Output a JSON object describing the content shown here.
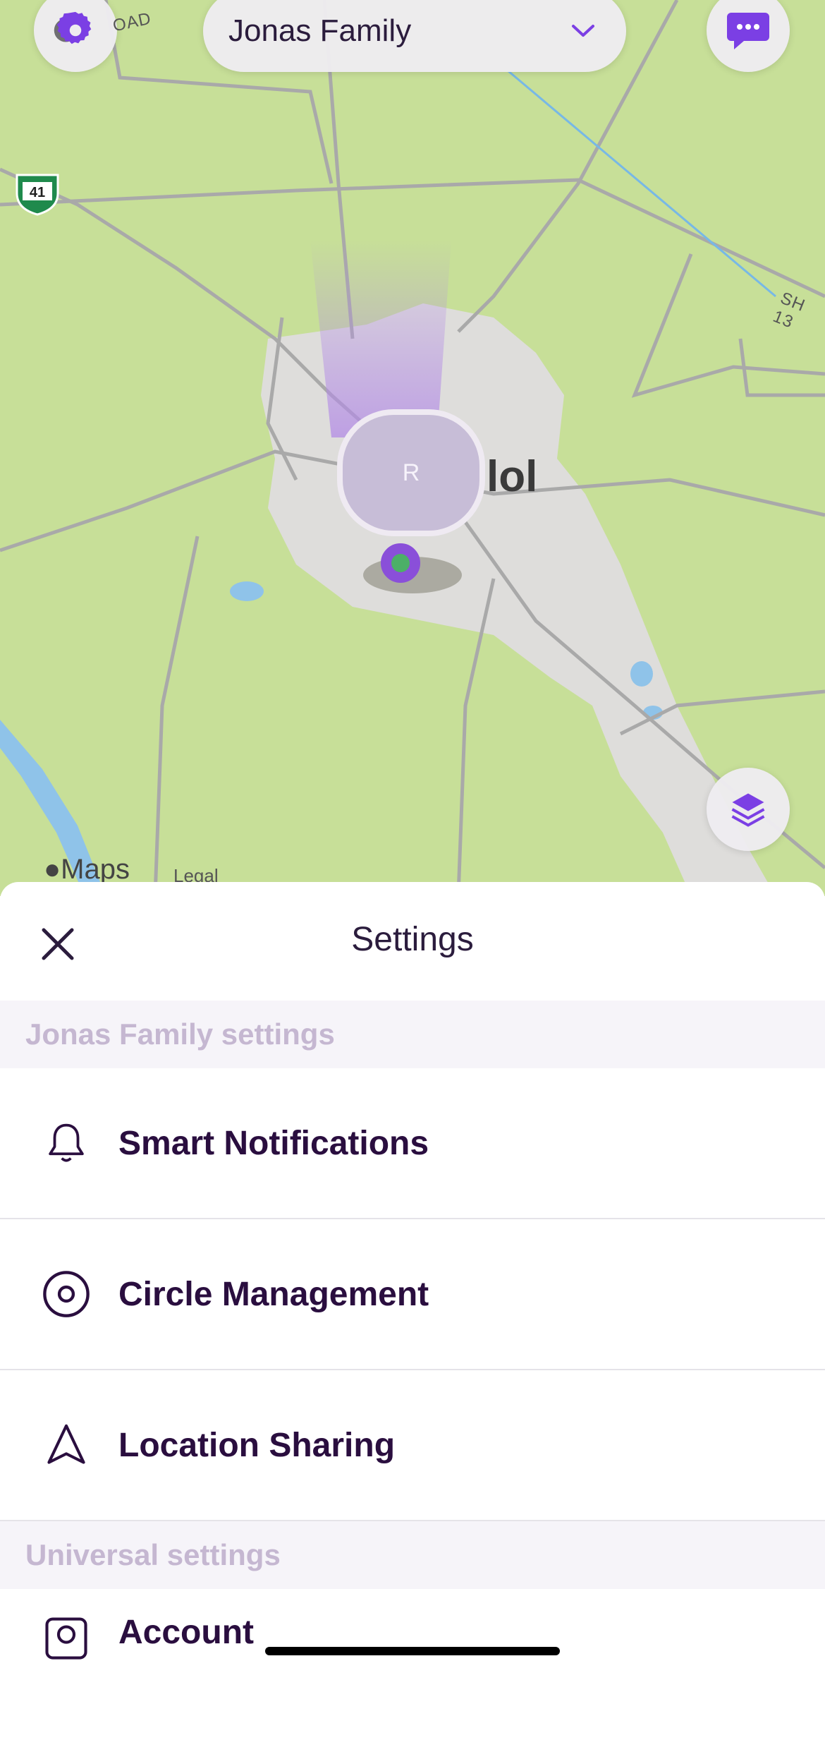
{
  "header": {
    "circle_name": "Jonas Family",
    "colors": {
      "accent": "#7b3fe4",
      "button_bg": "#eeecf0"
    }
  },
  "map": {
    "road_labels": {
      "highway_shield": "41",
      "road_top": "OAD",
      "road_right": "SH 13"
    },
    "city_label": "lol",
    "avatar_initial": "R",
    "attribution": "Maps",
    "legal": "Legal"
  },
  "settings_sheet": {
    "title": "Settings",
    "sections": [
      {
        "header": "Jonas Family settings",
        "items": [
          {
            "label": "Smart Notifications",
            "icon": "bell-icon"
          },
          {
            "label": "Circle Management",
            "icon": "circle-target-icon"
          },
          {
            "label": "Location Sharing",
            "icon": "navigation-arrow-icon"
          }
        ]
      },
      {
        "header": "Universal settings",
        "items": [
          {
            "label": "Account",
            "icon": "account-icon"
          }
        ]
      }
    ]
  }
}
